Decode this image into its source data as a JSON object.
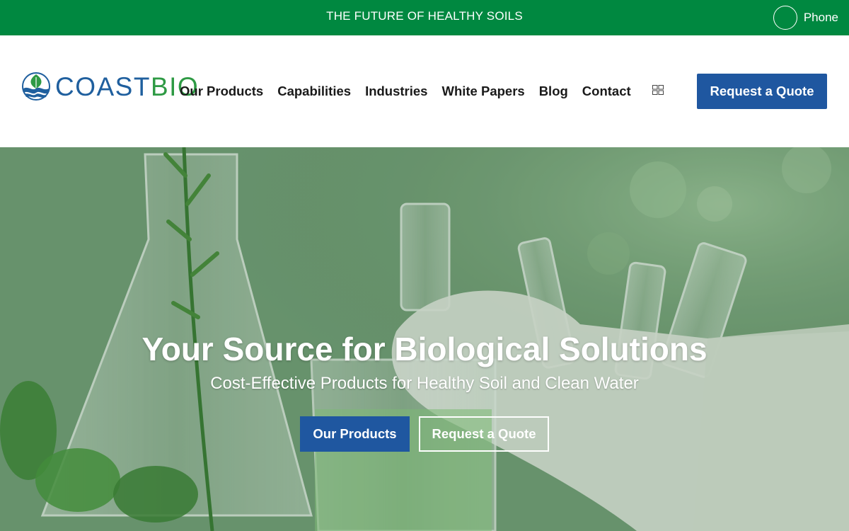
{
  "topbar": {
    "announcement": "THE FUTURE OF HEALTHY SOILS",
    "phone_label": "Phone",
    "background_color": "#008840"
  },
  "header": {
    "logo": {
      "part1": "COAST",
      "part2": "BIO",
      "icon": "leaf-globe-icon"
    },
    "nav": [
      {
        "label": "Our Products"
      },
      {
        "label": "Capabilities"
      },
      {
        "label": "Industries"
      },
      {
        "label": "White Papers"
      },
      {
        "label": "Blog"
      },
      {
        "label": "Contact"
      }
    ],
    "menu_icon": "grid-icon",
    "cta_label": "Request a Quote",
    "accent_color": "#1f57a0"
  },
  "hero": {
    "title": "Your Source for Biological Solutions",
    "subtitle": "Cost-Effective Products for Healthy Soil and Clean Water",
    "primary_button": "Our Products",
    "secondary_button": "Request a Quote",
    "image_description_icon": "laboratory-glassware-image"
  }
}
